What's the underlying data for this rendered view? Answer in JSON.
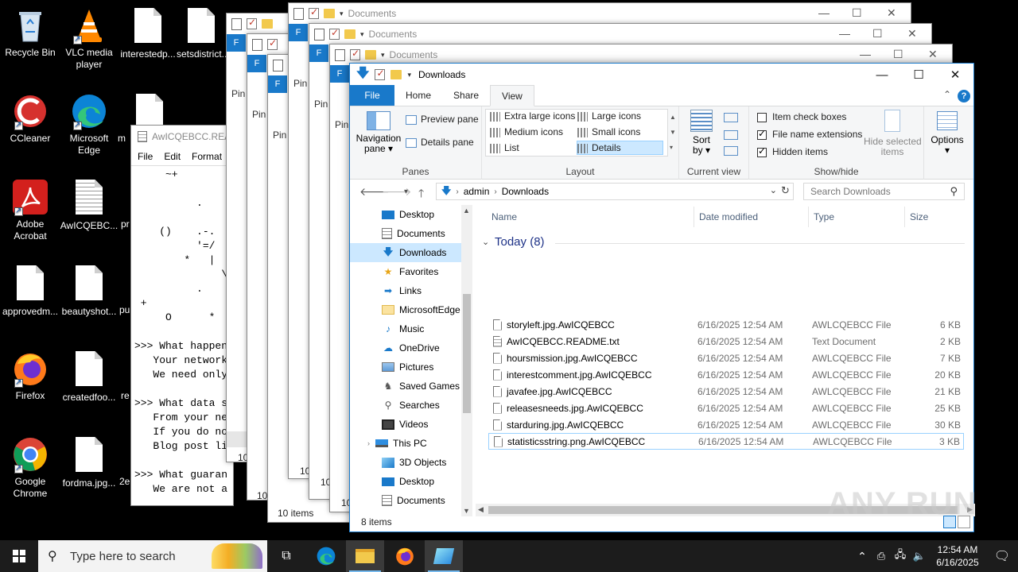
{
  "desktop": {
    "icons": [
      {
        "label": "Recycle Bin",
        "icon": "recycle-bin-icon"
      },
      {
        "label": "VLC media player",
        "icon": "vlc-icon"
      },
      {
        "label": "interestedp...",
        "icon": "document-icon"
      },
      {
        "label": "setsdistrict...",
        "icon": "document-icon"
      },
      {
        "label": "CCleaner",
        "icon": "ccleaner-icon"
      },
      {
        "label": "Microsoft Edge",
        "icon": "edge-icon"
      },
      {
        "label": "m",
        "icon": "document-icon"
      },
      {
        "label": "Adobe Acrobat",
        "icon": "acrobat-icon"
      },
      {
        "label": "AwICQEBC...",
        "icon": "text-document-icon"
      },
      {
        "label": "pr",
        "icon": "document-icon"
      },
      {
        "label": "approvedm...",
        "icon": "document-icon"
      },
      {
        "label": "beautyshot...",
        "icon": "document-icon"
      },
      {
        "label": "pu",
        "icon": "document-icon"
      },
      {
        "label": "Firefox",
        "icon": "firefox-icon"
      },
      {
        "label": "createdfoo...",
        "icon": "document-icon"
      },
      {
        "label": "re",
        "icon": "document-icon"
      },
      {
        "label": "Google Chrome",
        "icon": "chrome-icon"
      },
      {
        "label": "fordma.jpg...",
        "icon": "document-icon"
      },
      {
        "label": "2e",
        "icon": "document-icon"
      }
    ]
  },
  "notepad": {
    "title": "AwICQEBCC.REA",
    "menu": [
      "File",
      "Edit",
      "Format"
    ],
    "text": "     ~+\n\n          .\n\n    ()    .-.\n          '=/\n        *   |\n              \\\n          .\n +\n     O      *\n\n>>> What happen\n   Your network\n   We need only\n\n>>> What data s\n   From your ne\n   If you do no\n   Blog post li\n\n>>> What guaran\n   We are not a"
  },
  "back_windows": {
    "title": "Documents",
    "file_tab": "F",
    "pin_label": "Pin",
    "pin_label_alt": "Pin\na",
    "status_10_items": "10 items",
    "status_10": "10",
    "status_do": "Do"
  },
  "explorer": {
    "title": "Downloads",
    "tabs": [
      "File",
      "Home",
      "Share",
      "View"
    ],
    "active_tab": "View",
    "ribbon": {
      "panes": {
        "navigation_pane": "Navigation\npane ▾",
        "preview_pane": "Preview pane",
        "details_pane": "Details pane",
        "group": "Panes"
      },
      "layout": {
        "extra_large": "Extra large icons",
        "large": "Large icons",
        "medium": "Medium icons",
        "small": "Small icons",
        "list": "List",
        "details": "Details",
        "group": "Layout"
      },
      "current_view": {
        "sort_by": "Sort\nby ▾",
        "group": "Current view"
      },
      "show_hide": {
        "item_check_boxes": "Item check boxes",
        "file_name_extensions": "File name extensions",
        "hidden_items": "Hidden items",
        "hide_selected": "Hide selected\nitems",
        "group": "Show/hide"
      },
      "options": "Options\n▾"
    },
    "address": {
      "path": [
        "admin",
        "Downloads"
      ],
      "search_placeholder": "Search Downloads"
    },
    "nav_pane": [
      {
        "label": "Desktop",
        "icon": "desktop-folder-icon",
        "indent": 1
      },
      {
        "label": "Documents",
        "icon": "documents-folder-icon",
        "indent": 1
      },
      {
        "label": "Downloads",
        "icon": "downloads-folder-icon",
        "indent": 1,
        "selected": true
      },
      {
        "label": "Favorites",
        "icon": "star-icon",
        "indent": 1
      },
      {
        "label": "Links",
        "icon": "links-icon",
        "indent": 1
      },
      {
        "label": "MicrosoftEdge",
        "icon": "folder-icon",
        "indent": 1
      },
      {
        "label": "Music",
        "icon": "music-icon",
        "indent": 1
      },
      {
        "label": "OneDrive",
        "icon": "onedrive-icon",
        "indent": 1
      },
      {
        "label": "Pictures",
        "icon": "pictures-icon",
        "indent": 1
      },
      {
        "label": "Saved Games",
        "icon": "saved-games-icon",
        "indent": 1
      },
      {
        "label": "Searches",
        "icon": "searches-icon",
        "indent": 1
      },
      {
        "label": "Videos",
        "icon": "videos-icon",
        "indent": 1
      },
      {
        "label": "This PC",
        "icon": "this-pc-icon",
        "indent": 0
      },
      {
        "label": "3D Objects",
        "icon": "3d-objects-icon",
        "indent": 1
      },
      {
        "label": "Desktop",
        "icon": "desktop-folder-icon",
        "indent": 1
      },
      {
        "label": "Documents",
        "icon": "documents-folder-icon",
        "indent": 1
      }
    ],
    "columns": {
      "name": "Name",
      "date": "Date modified",
      "type": "Type",
      "size": "Size"
    },
    "group_title": "Today (8)",
    "files": [
      {
        "name": "storyleft.jpg.AwICQEBCC",
        "date": "6/16/2025 12:54 AM",
        "type": "AWLCQEBCC File",
        "size": "6 KB"
      },
      {
        "name": "AwICQEBCC.README.txt",
        "date": "6/16/2025 12:54 AM",
        "type": "Text Document",
        "size": "2 KB"
      },
      {
        "name": "hoursmission.jpg.AwICQEBCC",
        "date": "6/16/2025 12:54 AM",
        "type": "AWLCQEBCC File",
        "size": "7 KB"
      },
      {
        "name": "interestcomment.jpg.AwICQEBCC",
        "date": "6/16/2025 12:54 AM",
        "type": "AWLCQEBCC File",
        "size": "20 KB"
      },
      {
        "name": "javafee.jpg.AwICQEBCC",
        "date": "6/16/2025 12:54 AM",
        "type": "AWLCQEBCC File",
        "size": "21 KB"
      },
      {
        "name": "releasesneeds.jpg.AwICQEBCC",
        "date": "6/16/2025 12:54 AM",
        "type": "AWLCQEBCC File",
        "size": "25 KB"
      },
      {
        "name": "starduring.jpg.AwICQEBCC",
        "date": "6/16/2025 12:54 AM",
        "type": "AWLCQEBCC File",
        "size": "30 KB"
      },
      {
        "name": "statisticsstring.png.AwICQEBCC",
        "date": "6/16/2025 12:54 AM",
        "type": "AWLCQEBCC File",
        "size": "3 KB"
      }
    ],
    "status": "8 items"
  },
  "taskbar": {
    "search_placeholder": "Type here to search",
    "time": "12:54 AM",
    "date": "6/16/2025"
  },
  "watermark": "ANY RUN"
}
